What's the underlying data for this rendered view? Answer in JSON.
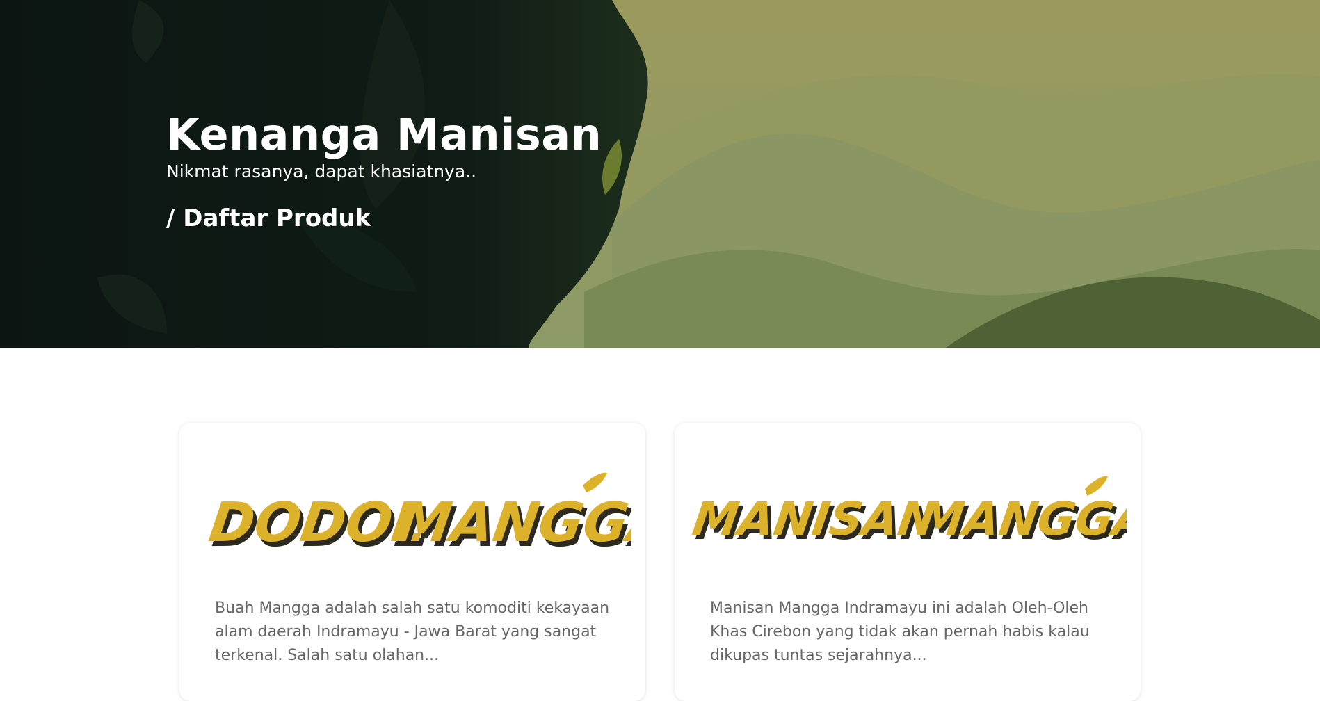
{
  "hero": {
    "title": "Kenanga Manisan",
    "tagline": "Nikmat rasanya, dapat khasiatnya..",
    "breadcrumb": "/ Daftar Produk"
  },
  "products": [
    {
      "logo_line1": "DODOL",
      "logo_line2": "MANGGA",
      "description": "Buah Mangga adalah salah satu komoditi kekayaan alam daerah Indramayu - Jawa Barat yang sangat terkenal. Salah satu olahan..."
    },
    {
      "logo_line1": "MANISAN",
      "logo_line2": "MANGGA",
      "description": "Manisan Mangga Indramayu ini adalah Oleh-Oleh Khas Cirebon yang tidak akan pernah habis kalau dikupas tuntas sejarahnya..."
    }
  ],
  "colors": {
    "logo_yellow": "#dcb22b",
    "logo_shadow": "#2c2a1e",
    "hero_dark": "#0c1512",
    "hero_olive": "#8f9561",
    "text_gray": "#666666"
  }
}
